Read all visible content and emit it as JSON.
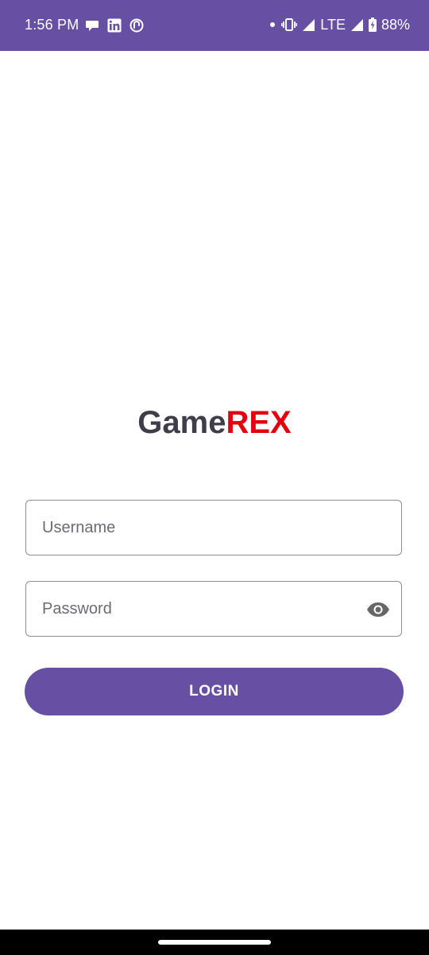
{
  "status_bar": {
    "time": "1:56 PM",
    "network": "LTE",
    "battery": "88%",
    "left_icons": [
      "chat-bubble-icon",
      "linkedin-icon",
      "app-notification-icon"
    ],
    "right_icons": [
      "dot-icon",
      "vibrate-icon",
      "wifi-signal-icon",
      "cell-signal-icon",
      "battery-charging-icon"
    ],
    "background_color": "#6750a4"
  },
  "logo": {
    "part1": "Game",
    "part2": "REX",
    "part1_color": "#3f3d4a",
    "part2_color": "#e4000f"
  },
  "form": {
    "username_placeholder": "Username",
    "username_value": "",
    "password_placeholder": "Password",
    "password_value": "",
    "password_toggle_icon": "eye-icon",
    "login_label": "LOGIN"
  },
  "colors": {
    "accent": "#6750a4",
    "field_border": "#8e8c94",
    "placeholder_text": "#6d6b73"
  }
}
